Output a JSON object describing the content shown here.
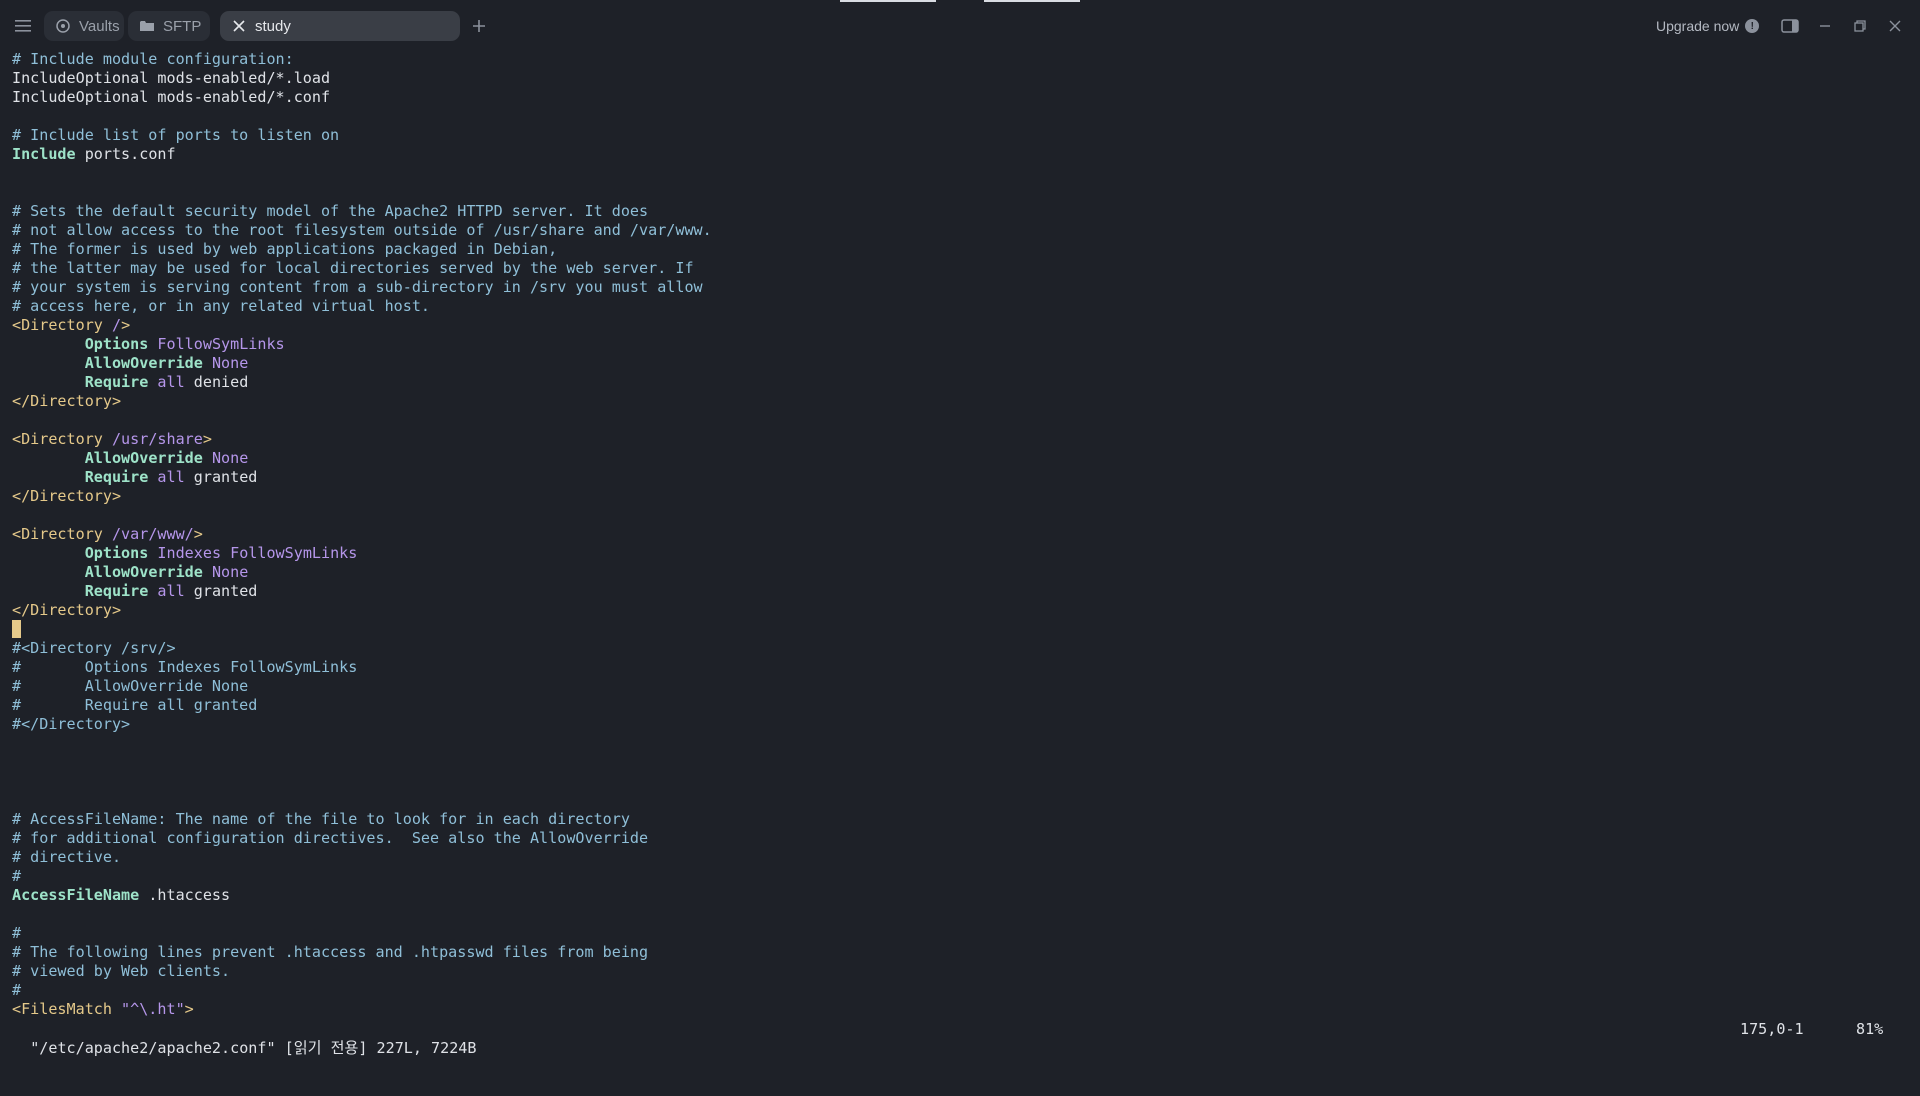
{
  "window": {
    "tabs": [
      {
        "label": "Vaults",
        "icon": "vault-icon"
      },
      {
        "label": "SFTP",
        "icon": "folder-icon"
      },
      {
        "label": "study",
        "icon": "close-icon"
      }
    ],
    "upgrade_label": "Upgrade now",
    "upgrade_badge": "!"
  },
  "editor": {
    "lines": [
      [
        [
          "c-comment",
          "# Include module configuration:"
        ]
      ],
      [
        [
          "c-text",
          "IncludeOptional mods-enabled/*.load"
        ]
      ],
      [
        [
          "c-text",
          "IncludeOptional mods-enabled/*.conf"
        ]
      ],
      [],
      [
        [
          "c-comment",
          "# Include list of ports to listen on"
        ]
      ],
      [
        [
          "c-kw",
          "Include"
        ],
        [
          "c-text",
          " ports.conf"
        ]
      ],
      [],
      [],
      [
        [
          "c-comment",
          "# Sets the default security model of the Apache2 HTTPD server. It does"
        ]
      ],
      [
        [
          "c-comment",
          "# not allow access to the root filesystem outside of /usr/share and /var/www."
        ]
      ],
      [
        [
          "c-comment",
          "# The former is used by web applications packaged in Debian,"
        ]
      ],
      [
        [
          "c-comment",
          "# the latter may be used for local directories served by the web server. If"
        ]
      ],
      [
        [
          "c-comment",
          "# your system is serving content from a sub-directory in /srv you must allow"
        ]
      ],
      [
        [
          "c-comment",
          "# access here, or in any related virtual host."
        ]
      ],
      [
        [
          "c-tag",
          "<Directory "
        ],
        [
          "c-val",
          "/"
        ],
        [
          "c-tag",
          ">"
        ]
      ],
      [
        [
          "c-text",
          "        "
        ],
        [
          "c-kw",
          "Options"
        ],
        [
          "c-text",
          " "
        ],
        [
          "c-val",
          "FollowSymLinks"
        ]
      ],
      [
        [
          "c-text",
          "        "
        ],
        [
          "c-kw",
          "AllowOverride"
        ],
        [
          "c-text",
          " "
        ],
        [
          "c-val",
          "None"
        ]
      ],
      [
        [
          "c-text",
          "        "
        ],
        [
          "c-kw",
          "Require"
        ],
        [
          "c-text",
          " "
        ],
        [
          "c-val",
          "all"
        ],
        [
          "c-text",
          " denied"
        ]
      ],
      [
        [
          "c-tag",
          "</Directory>"
        ]
      ],
      [],
      [
        [
          "c-tag",
          "<Directory "
        ],
        [
          "c-val",
          "/usr/share"
        ],
        [
          "c-tag",
          ">"
        ]
      ],
      [
        [
          "c-text",
          "        "
        ],
        [
          "c-kw",
          "AllowOverride"
        ],
        [
          "c-text",
          " "
        ],
        [
          "c-val",
          "None"
        ]
      ],
      [
        [
          "c-text",
          "        "
        ],
        [
          "c-kw",
          "Require"
        ],
        [
          "c-text",
          " "
        ],
        [
          "c-val",
          "all"
        ],
        [
          "c-text",
          " granted"
        ]
      ],
      [
        [
          "c-tag",
          "</Directory>"
        ]
      ],
      [],
      [
        [
          "c-tag",
          "<Directory "
        ],
        [
          "c-val",
          "/var/www/"
        ],
        [
          "c-tag",
          ">"
        ]
      ],
      [
        [
          "c-text",
          "        "
        ],
        [
          "c-kw",
          "Options"
        ],
        [
          "c-text",
          " "
        ],
        [
          "c-val",
          "Indexes FollowSymLinks"
        ]
      ],
      [
        [
          "c-text",
          "        "
        ],
        [
          "c-kw",
          "AllowOverride"
        ],
        [
          "c-text",
          " "
        ],
        [
          "c-val",
          "None"
        ]
      ],
      [
        [
          "c-text",
          "        "
        ],
        [
          "c-kw",
          "Require"
        ],
        [
          "c-text",
          " "
        ],
        [
          "c-val",
          "all"
        ],
        [
          "c-text",
          " granted"
        ]
      ],
      [
        [
          "c-tag",
          "</Directory>"
        ]
      ],
      [
        [
          "cursor",
          ""
        ]
      ],
      [
        [
          "c-comment",
          "#<Directory /srv/>"
        ]
      ],
      [
        [
          "c-comment",
          "#       Options Indexes FollowSymLinks"
        ]
      ],
      [
        [
          "c-comment",
          "#       AllowOverride None"
        ]
      ],
      [
        [
          "c-comment",
          "#       Require all granted"
        ]
      ],
      [
        [
          "c-comment",
          "#</Directory>"
        ]
      ],
      [],
      [],
      [],
      [],
      [
        [
          "c-comment",
          "# AccessFileName: The name of the file to look for in each directory"
        ]
      ],
      [
        [
          "c-comment",
          "# for additional configuration directives.  See also the AllowOverride"
        ]
      ],
      [
        [
          "c-comment",
          "# directive."
        ]
      ],
      [
        [
          "c-comment",
          "#"
        ]
      ],
      [
        [
          "c-kw",
          "AccessFileName"
        ],
        [
          "c-text",
          " .htaccess"
        ]
      ],
      [],
      [
        [
          "c-comment",
          "#"
        ]
      ],
      [
        [
          "c-comment",
          "# The following lines prevent .htaccess and .htpasswd files from being"
        ]
      ],
      [
        [
          "c-comment",
          "# viewed by Web clients."
        ]
      ],
      [
        [
          "c-comment",
          "#"
        ]
      ],
      [
        [
          "c-tag",
          "<FilesMatch "
        ],
        [
          "c-val",
          "\"^\\.ht\""
        ],
        [
          "c-tag",
          ">"
        ]
      ]
    ]
  },
  "status": {
    "file": "\"/etc/apache2/apache2.conf\" [읽기 전용] 227L, 7224B",
    "position": "175,0-1",
    "percent": "81%"
  }
}
